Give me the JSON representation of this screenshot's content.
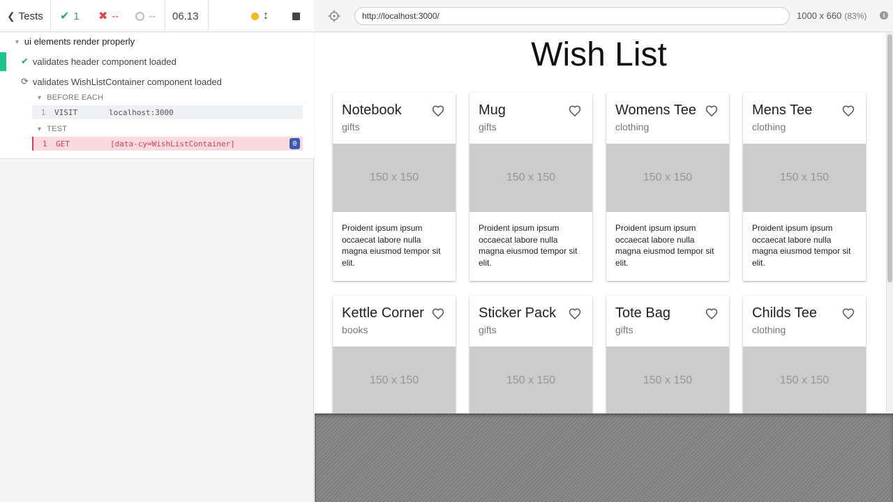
{
  "reporter": {
    "tests_label": "Tests",
    "passed_count": "1",
    "failed_count": "--",
    "pending_count": "--",
    "duration": "06.13",
    "suite": {
      "title": "ui elements render properly",
      "tests": [
        {
          "title": "validates header component loaded",
          "state": "passed"
        },
        {
          "title": "validates WishListContainer component loaded",
          "state": "running"
        }
      ]
    },
    "hooks": {
      "before_each_label": "BEFORE EACH",
      "test_label": "TEST"
    },
    "commands": {
      "visit": {
        "num": "1",
        "name": "VISIT",
        "message": "localhost:3000"
      },
      "get": {
        "num": "1",
        "name": "GET",
        "message": "[data-cy=WishListContainer]",
        "badge": "0"
      }
    }
  },
  "runner": {
    "url": "http://localhost:3000/",
    "viewport": "1000 x 660",
    "scale": "(83%)"
  },
  "app": {
    "title": "Wish List",
    "image_placeholder": "150 x 150",
    "cards": [
      {
        "title": "Notebook",
        "category": "gifts",
        "description": "Proident ipsum ipsum occaecat labore nulla magna eiusmod tempor sit elit."
      },
      {
        "title": "Mug",
        "category": "gifts",
        "description": "Proident ipsum ipsum occaecat labore nulla magna eiusmod tempor sit elit."
      },
      {
        "title": "Womens Tee",
        "category": "clothing",
        "description": "Proident ipsum ipsum occaecat labore nulla magna eiusmod tempor sit elit."
      },
      {
        "title": "Mens Tee",
        "category": "clothing",
        "description": "Proident ipsum ipsum occaecat labore nulla magna eiusmod tempor sit elit."
      },
      {
        "title": "Kettle Corner",
        "category": "books"
      },
      {
        "title": "Sticker Pack",
        "category": "gifts"
      },
      {
        "title": "Tote Bag",
        "category": "gifts"
      },
      {
        "title": "Childs Tee",
        "category": "clothing"
      }
    ]
  },
  "colors": {
    "pass": "#27a86b",
    "fail": "#e0444a",
    "running_dot": "#f8b81b",
    "failed_command_bg": "#fad9df",
    "placeholder_bg": "#cccccc"
  }
}
